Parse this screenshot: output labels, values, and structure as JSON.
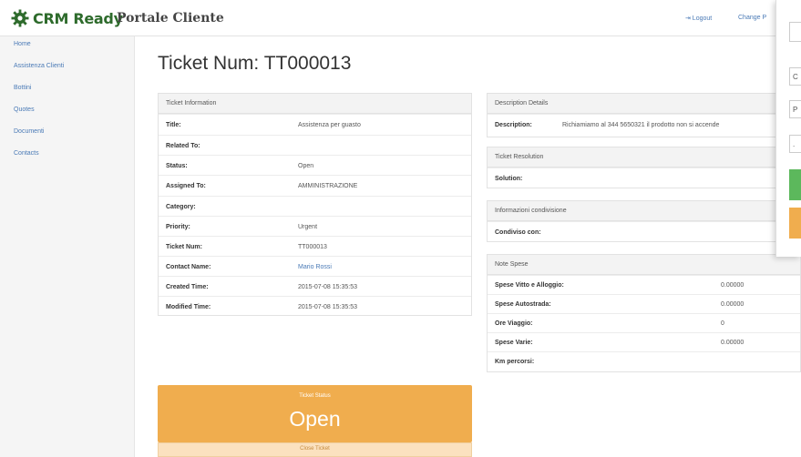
{
  "header": {
    "logo_text": "CRM Ready",
    "portal_title": "Portale Cliente",
    "logout_label": "⇥ Logout",
    "change_label": "Change P"
  },
  "sidebar": {
    "items": [
      {
        "label": "Home"
      },
      {
        "label": "Assistenza Clienti"
      },
      {
        "label": "Bottini"
      },
      {
        "label": "Quotes"
      },
      {
        "label": "Documenti"
      },
      {
        "label": "Contacts"
      }
    ]
  },
  "page": {
    "title": "Ticket Num: TT000013"
  },
  "ticket_info": {
    "heading": "Ticket Information",
    "rows": [
      {
        "label": "Title:",
        "value": "Assistenza per guasto"
      },
      {
        "label": "Related To:",
        "value": ""
      },
      {
        "label": "Status:",
        "value": "Open"
      },
      {
        "label": "Assigned To:",
        "value": "AMMINISTRAZIONE"
      },
      {
        "label": "Category:",
        "value": ""
      },
      {
        "label": "Priority:",
        "value": "Urgent"
      },
      {
        "label": "Ticket Num:",
        "value": "TT000013"
      },
      {
        "label": "Contact Name:",
        "value": "Mario Rossi"
      },
      {
        "label": "Created Time:",
        "value": "2015-07-08 15:35:53"
      },
      {
        "label": "Modified Time:",
        "value": "2015-07-08 15:35:53"
      }
    ]
  },
  "description": {
    "heading": "Description Details",
    "label": "Description:",
    "value": "Richiamiamo al 344 5650321 il prodotto non si accende"
  },
  "resolution": {
    "heading": "Ticket Resolution",
    "label": "Solution:"
  },
  "sharing": {
    "heading": "Informazioni condivisione",
    "label": "Condiviso con:"
  },
  "expenses": {
    "heading": "Note Spese",
    "rows": [
      {
        "label": "Spese Vitto e Alloggio:",
        "value": "0.00000"
      },
      {
        "label": "Spese Autostrada:",
        "value": "0.00000"
      },
      {
        "label": "Ore Viaggio:",
        "value": "0"
      },
      {
        "label": "Spese Varie:",
        "value": "0.00000"
      },
      {
        "label": "Km percorsi:",
        "value": ""
      }
    ]
  },
  "status_card": {
    "label": "Ticket Status",
    "value": "Open",
    "close_label": "Close Ticket"
  },
  "overlay": {
    "fields": [
      "C",
      "P",
      "."
    ],
    "buttons": [
      {
        "color": "#5cb85c"
      },
      {
        "color": "#f0ad4e"
      }
    ]
  }
}
